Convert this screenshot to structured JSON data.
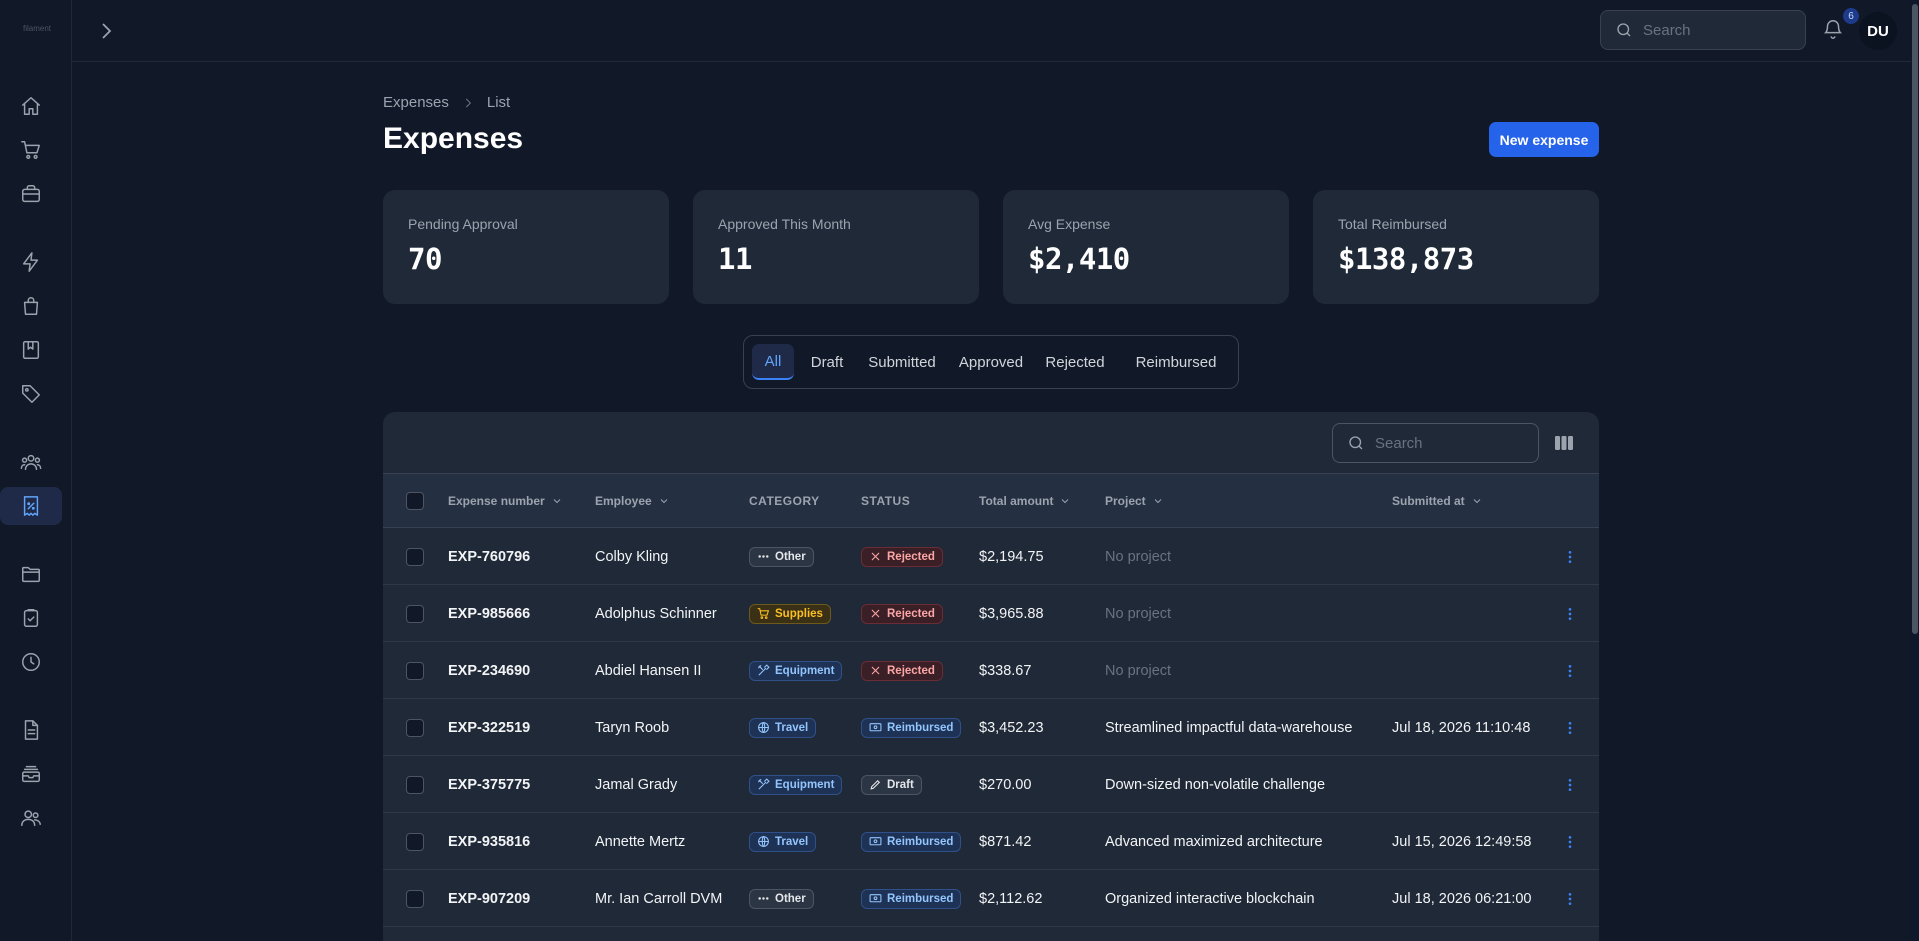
{
  "app": {
    "logo_text": "filament"
  },
  "sidebar": {
    "items": [
      {
        "icon": "home-icon"
      },
      {
        "icon": "cart-icon"
      },
      {
        "icon": "briefcase-icon"
      },
      {
        "icon": "bolt-icon"
      },
      {
        "icon": "shopping-bag-icon"
      },
      {
        "icon": "book-icon"
      },
      {
        "icon": "tag-icon"
      },
      {
        "icon": "user-group-icon"
      },
      {
        "icon": "receipt-percent-icon",
        "active": true
      },
      {
        "icon": "folder-icon"
      },
      {
        "icon": "clipboard-check-icon"
      },
      {
        "icon": "clock-icon"
      },
      {
        "icon": "document-text-icon"
      },
      {
        "icon": "inbox-stack-icon"
      },
      {
        "icon": "users-icon"
      }
    ]
  },
  "topbar": {
    "search_placeholder": "Search",
    "notifications_count": "6",
    "avatar_initials": "DU"
  },
  "header": {
    "breadcrumb": [
      "Expenses",
      "List"
    ],
    "title": "Expenses",
    "new_button": "New expense"
  },
  "stats": [
    {
      "label": "Pending Approval",
      "value": "70"
    },
    {
      "label": "Approved This Month",
      "value": "11"
    },
    {
      "label": "Avg Expense",
      "value": "$2,410"
    },
    {
      "label": "Total Reimbursed",
      "value": "$138,873"
    }
  ],
  "tabs": [
    {
      "label": "All",
      "active": true
    },
    {
      "label": "Draft"
    },
    {
      "label": "Submitted"
    },
    {
      "label": "Approved"
    },
    {
      "label": "Rejected"
    },
    {
      "label": "Reimbursed"
    }
  ],
  "table": {
    "search_placeholder": "Search",
    "columns": [
      "Expense number",
      "Employee",
      "CATEGORY",
      "STATUS",
      "Total amount",
      "Project",
      "Submitted at"
    ],
    "rows": [
      {
        "number": "EXP-760796",
        "employee": "Colby Kling",
        "category": "Other",
        "status": "Rejected",
        "amount": "$2,194.75",
        "project": "No project",
        "submitted": ""
      },
      {
        "number": "EXP-985666",
        "employee": "Adolphus Schinner",
        "category": "Supplies",
        "status": "Rejected",
        "amount": "$3,965.88",
        "project": "No project",
        "submitted": ""
      },
      {
        "number": "EXP-234690",
        "employee": "Abdiel Hansen II",
        "category": "Equipment",
        "status": "Rejected",
        "amount": "$338.67",
        "project": "No project",
        "submitted": ""
      },
      {
        "number": "EXP-322519",
        "employee": "Taryn Roob",
        "category": "Travel",
        "status": "Reimbursed",
        "amount": "$3,452.23",
        "project": "Streamlined impactful data-warehouse",
        "submitted": "Jul 18, 2026 11:10:48"
      },
      {
        "number": "EXP-375775",
        "employee": "Jamal Grady",
        "category": "Equipment",
        "status": "Draft",
        "amount": "$270.00",
        "project": "Down-sized non-volatile challenge",
        "submitted": ""
      },
      {
        "number": "EXP-935816",
        "employee": "Annette Mertz",
        "category": "Travel",
        "status": "Reimbursed",
        "amount": "$871.42",
        "project": "Advanced maximized architecture",
        "submitted": "Jul 15, 2026 12:49:58"
      },
      {
        "number": "EXP-907209",
        "employee": "Mr. Ian Carroll DVM",
        "category": "Other",
        "status": "Reimbursed",
        "amount": "$2,112.62",
        "project": "Organized interactive blockchain",
        "submitted": "Jul 18, 2026 06:21:00"
      }
    ]
  },
  "colors": {
    "background": "#111827",
    "card": "#1f2937",
    "accent": "#2563eb",
    "rejected": "#fca5a5",
    "reimbursed": "#93c5fd",
    "supplies": "#fbbf24"
  }
}
